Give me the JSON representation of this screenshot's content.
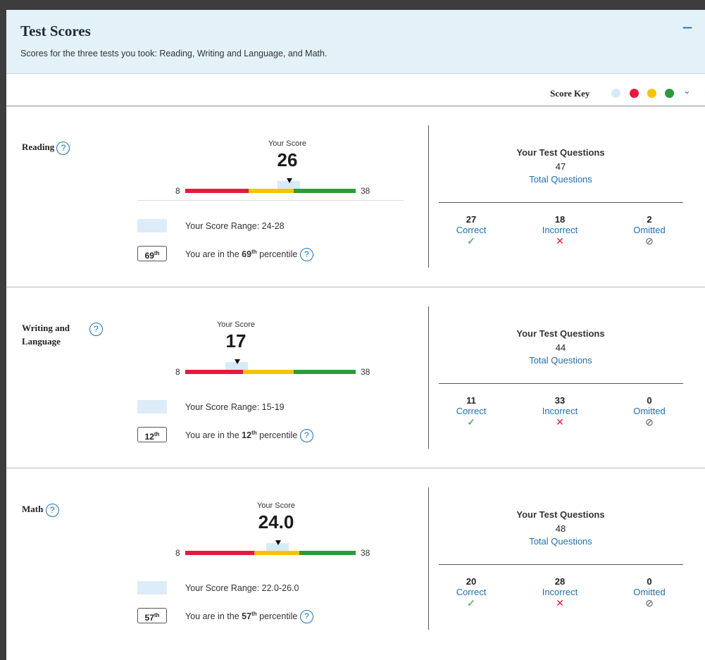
{
  "header": {
    "title": "Test Scores",
    "subtitle": "Scores for the three tests you took: Reading, Writing and Language, and Math.",
    "collapse_label": "−"
  },
  "score_key": {
    "label": "Score Key",
    "colors": [
      "#d6ebf8",
      "#e8183c",
      "#f5c400",
      "#2c9a3b"
    ],
    "chevron": "⌄"
  },
  "common": {
    "your_score_label": "Your Score",
    "scale_min": "8",
    "scale_max": "38",
    "range_prefix": "Your Score Range: ",
    "percentile_prefix": "You are in the ",
    "percentile_suffix": " percentile",
    "questions_title": "Your Test Questions",
    "total_label": "Total Questions",
    "correct_label": "Correct",
    "incorrect_label": "Incorrect",
    "omitted_label": "Omitted",
    "help_glyph": "?",
    "correct_icon": "✓",
    "incorrect_icon": "✕",
    "omitted_icon": "⊘",
    "th": "th"
  },
  "sections": [
    {
      "title": "Reading",
      "score": "26",
      "score_range": "24-28",
      "percentile": "69",
      "total_questions": "47",
      "correct": "27",
      "incorrect": "18",
      "omitted": "2"
    },
    {
      "title": "Writing and Language",
      "score": "17",
      "score_range": "15-19",
      "percentile": "12",
      "total_questions": "44",
      "correct": "11",
      "incorrect": "33",
      "omitted": "0"
    },
    {
      "title": "Math",
      "score": "24.0",
      "score_range": "22.0-26.0",
      "percentile": "57",
      "total_questions": "48",
      "correct": "20",
      "incorrect": "28",
      "omitted": "0"
    }
  ]
}
